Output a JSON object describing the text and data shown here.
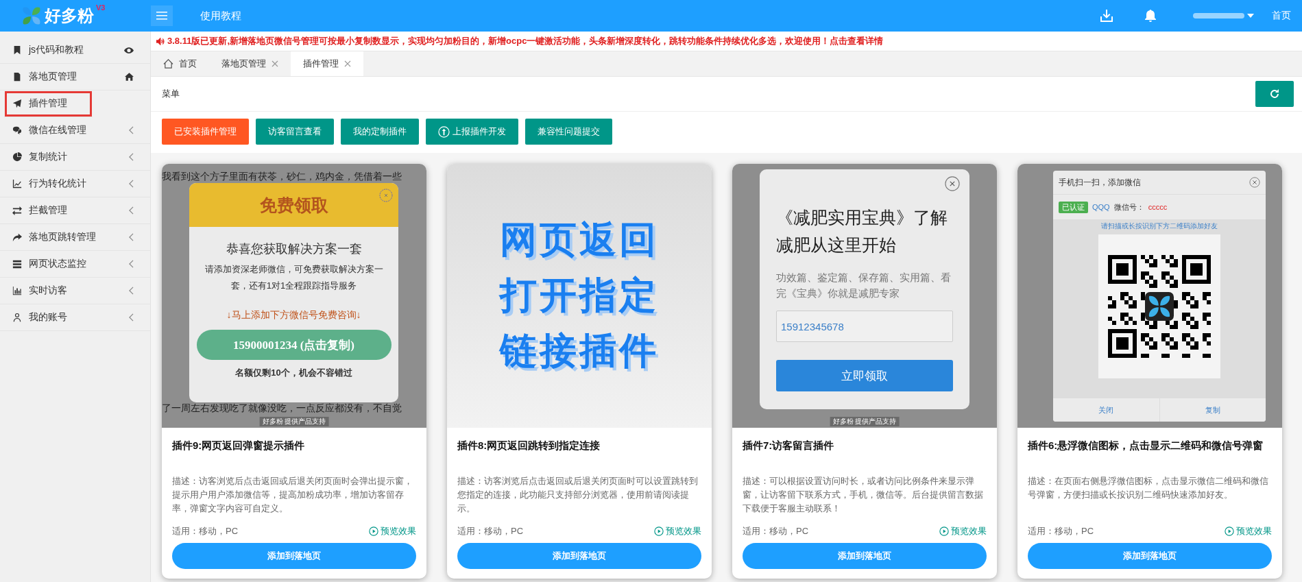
{
  "header": {
    "logo_text": "好多粉",
    "logo_badge": "V3",
    "nav_link": "使用教程",
    "home_link": "首页"
  },
  "sidebar": {
    "items": [
      {
        "label": "js代码和教程",
        "kind": "eye",
        "selected": false
      },
      {
        "label": "落地页管理",
        "kind": "home",
        "selected": false
      },
      {
        "label": "插件管理",
        "kind": "plain",
        "selected": true
      },
      {
        "label": "微信在线管理",
        "kind": "submenu",
        "selected": false
      },
      {
        "label": "复制统计",
        "kind": "submenu",
        "selected": false
      },
      {
        "label": "行为转化统计",
        "kind": "submenu",
        "selected": false
      },
      {
        "label": "拦截管理",
        "kind": "submenu",
        "selected": false
      },
      {
        "label": "落地页跳转管理",
        "kind": "submenu",
        "selected": false
      },
      {
        "label": "网页状态监控",
        "kind": "submenu",
        "selected": false
      },
      {
        "label": "实时访客",
        "kind": "submenu",
        "selected": false
      },
      {
        "label": "我的账号",
        "kind": "submenu",
        "selected": false
      }
    ]
  },
  "notice": {
    "text": "3.8.11版已更新,新增落地页微信号管理可按最小复制数显示，实现均匀加粉目的，新增ocpc一键激活功能，头条新增深度转化，跳转功能条件持续优化多选，欢迎使用！点击查看详情"
  },
  "tabs": [
    {
      "label": "首页",
      "kind": "home",
      "selected": false
    },
    {
      "label": "落地页管理",
      "kind": "page",
      "selected": false
    },
    {
      "label": "插件管理",
      "kind": "page",
      "selected": true
    }
  ],
  "panel": {
    "title": "菜单"
  },
  "action_buttons": [
    {
      "label": "已安装插件管理",
      "kind": "plain",
      "color": "#ff5722"
    },
    {
      "label": "访客留言查看",
      "kind": "plain",
      "color": "#009688"
    },
    {
      "label": "我的定制插件",
      "kind": "plain",
      "color": "#009688"
    },
    {
      "label": "上报插件开发",
      "kind": "upload",
      "color": "#009688"
    },
    {
      "label": "兼容性问题提交",
      "kind": "plain",
      "color": "#009688"
    }
  ],
  "cards": [
    {
      "preview": {
        "kind": "offer_popup",
        "article_first_line": "我看到这个方子里面有茯苓，砂仁，鸡内金，凭借着一些",
        "article_last_line": "了一周左右发现吃了就像没吃，一点反应都没有，不自觉",
        "header": "免费领取",
        "heading": "恭喜您获取解决方案一套",
        "body": "请添加资深老师微信，可免费获取解决方案一套，还有1对1全程跟踪指导服务",
        "hint": "↓马上添加下方微信号免费咨询↓",
        "button": "15900001234 (点击复制)",
        "footer": "名额仅剩10个，机会不容错过",
        "credit": "好多粉 提供产品支持"
      },
      "title": "插件9:网页返回弹窗提示插件",
      "description": "描述：访客浏览后点击返回或后退关闭页面时会弹出提示窗，提示用户用户添加微信等，提高加粉成功率，增加访客留存率，弹窗文字内容可自定义。",
      "platforms": "适用：移动，PC",
      "preview_link": "预览效果",
      "add_button": "添加到落地页"
    },
    {
      "preview": {
        "kind": "banner",
        "lines": [
          "网页返回",
          "打开指定",
          "链接插件"
        ]
      },
      "title": "插件8:网页返回跳转到指定连接",
      "description": "描述：访客浏览后点击返回或后退关闭页面时可以设置跳转到您指定的连接，此功能只支持部分浏览器，使用前请阅读提示。",
      "platforms": "适用：移动，PC",
      "preview_link": "预览效果",
      "add_button": "添加到落地页"
    },
    {
      "preview": {
        "kind": "form_popup",
        "heading": "《减肥实用宝典》了解减肥从这里开始",
        "body": "功效篇、鉴定篇、保存篇、实用篇、看完《宝典》你就是减肥专家",
        "input_value": "15912345678",
        "button": "立即领取",
        "credit": "好多粉 提供产品支持"
      },
      "title": "插件7:访客留言插件",
      "description": "描述：可以根据设置访问时长，或者访问比例条件来显示弹窗，让访客留下联系方式，手机，微信等。后台提供留言数据下载便于客服主动联系！",
      "platforms": "适用：移动，PC",
      "preview_link": "预览效果",
      "add_button": "添加到落地页"
    },
    {
      "preview": {
        "kind": "qr_popup",
        "header": "手机扫一扫，添加微信",
        "verified": "已认证",
        "account": "QQQ",
        "id_label": "微信号：",
        "id_value": "ccccc",
        "hint": "请扫描或长按识别下方二维码添加好友",
        "buttons": [
          "关闭",
          "复制"
        ]
      },
      "title": "插件6:悬浮微信图标，点击显示二维码和微信号弹窗",
      "description": "描述：在页面右侧悬浮微信图标，点击显示微信二维码和微信号弹窗，方便扫描或长按识别二维码快速添加好友。",
      "platforms": "适用：移动，PC",
      "preview_link": "预览效果",
      "add_button": "添加到落地页"
    }
  ]
}
